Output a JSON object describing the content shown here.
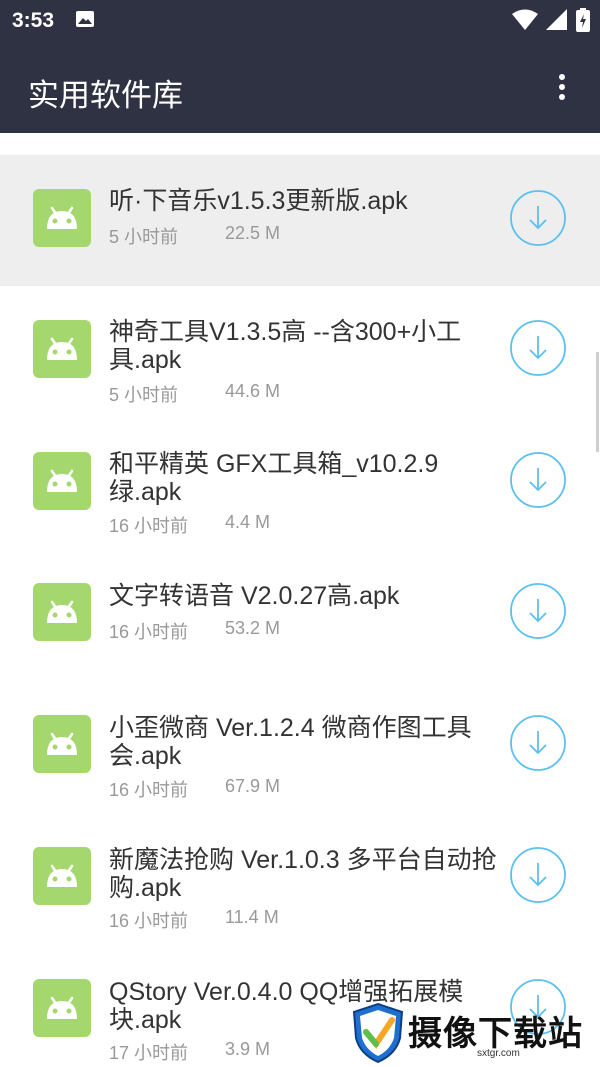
{
  "status_bar": {
    "time": "3:53"
  },
  "app_bar": {
    "title": "实用软件库"
  },
  "files": [
    {
      "name": "听·下音乐v1.5.3更新版.apk",
      "time": "5 小时前",
      "size": "22.5 M"
    },
    {
      "name": "神奇工具V1.3.5高 --含300+小工具.apk",
      "time": "5 小时前",
      "size": "44.6 M"
    },
    {
      "name": "和平精英 GFX工具箱_v10.2.9绿.apk",
      "time": "16 小时前",
      "size": "4.4 M"
    },
    {
      "name": "文字转语音 V2.0.27高.apk",
      "time": "16 小时前",
      "size": "53.2 M"
    },
    {
      "name": "小歪微商 Ver.1.2.4 微商作图工具会.apk",
      "time": "16 小时前",
      "size": "67.9 M"
    },
    {
      "name": "新魔法抢购 Ver.1.0.3 多平台自动抢购.apk",
      "time": "16 小时前",
      "size": "11.4 M"
    },
    {
      "name": "QStory Ver.0.4.0 QQ增强拓展模块.apk",
      "time": "17 小时前",
      "size": "3.9 M"
    }
  ],
  "watermark": {
    "text": "摄像下载站",
    "url": "sxtgr.com"
  },
  "colors": {
    "bar": "#2f3243",
    "icon_green": "#a4d86e",
    "download_blue": "#5bc0f0"
  }
}
